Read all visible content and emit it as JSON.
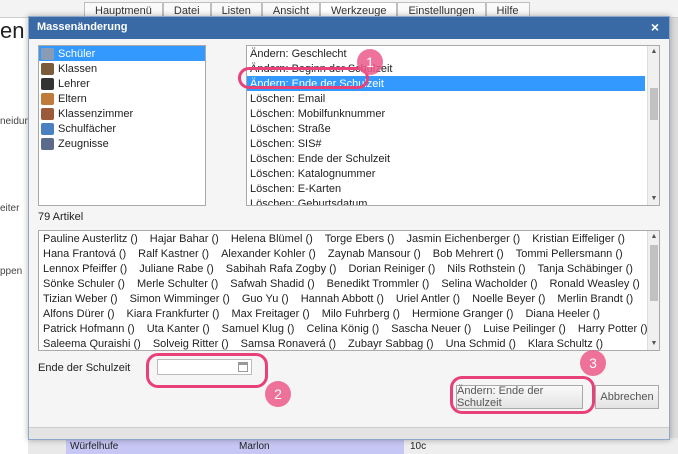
{
  "background": {
    "menu": [
      "Hauptmenü",
      "Datei",
      "Listen",
      "Ansicht",
      "Werkzeuge",
      "Einstellungen",
      "Hilfe"
    ],
    "menu_active_index": 4,
    "title_fragment": "en",
    "side_texts": [
      "neidun",
      "eiter",
      "ppen"
    ],
    "row": [
      "Würfelhufe",
      "Marlon"
    ],
    "row_extra": "10c"
  },
  "dialog": {
    "title": "Massenänderung",
    "close_label": "×",
    "types": [
      {
        "label": "Schüler",
        "icon": "student-icon",
        "selected": true,
        "color": "#8a9bb5"
      },
      {
        "label": "Klassen",
        "icon": "class-icon",
        "selected": false,
        "color": "#7a5b3a"
      },
      {
        "label": "Lehrer",
        "icon": "teacher-icon",
        "selected": false,
        "color": "#333333"
      },
      {
        "label": "Eltern",
        "icon": "parents-icon",
        "selected": false,
        "color": "#c07a3a"
      },
      {
        "label": "Klassenzimmer",
        "icon": "classroom-icon",
        "selected": false,
        "color": "#9b5a3a"
      },
      {
        "label": "Schulfächer",
        "icon": "subjects-icon",
        "selected": false,
        "color": "#4a7fc0"
      },
      {
        "label": "Zeugnisse",
        "icon": "certificate-icon",
        "selected": false,
        "color": "#5a6a8a"
      }
    ],
    "actions": [
      "Ändern: Geschlecht",
      "Ändern: Beginn der Schulzeit",
      "Ändern: Ende der Schulzeit",
      "Löschen: Email",
      "Löschen: Mobilfunknummer",
      "Löschen: Straße",
      "Löschen: SIS#",
      "Löschen: Ende der Schulzeit",
      "Löschen: Katalognummer",
      "Löschen: E-Karten",
      "Löschen: Geburtsdatum"
    ],
    "selected_action_index": 2,
    "count_label": "79 Artikel",
    "students": [
      [
        "Pauline Austerlitz ()",
        "Hajar Bahar ()",
        "Helena Blümel ()",
        "Torge Ebers ()",
        "Jasmin Eichenberger ()",
        "Kristian Eiffeliger ()"
      ],
      [
        "Hana Frantová ()",
        "Ralf Kastner ()",
        "Alexander Kohler ()",
        "Zaynab Mansour ()",
        "Bob Mehrert ()",
        "Tommi Pellersmann ()"
      ],
      [
        "Lennox Pfeiffer ()",
        "Juliane Rabe ()",
        "Sabihah Rafa Zogby ()",
        "Dorian Reiniger ()",
        "Nils Rothstein ()",
        "Tanja Schäbinger ()"
      ],
      [
        "Sönke Schuler ()",
        "Merle Schulter ()",
        "Safwah Shadid ()",
        "Benedikt Trommler ()",
        "Selina Wacholder ()",
        "Ronald Weasley ()"
      ],
      [
        "Tizian Weber ()",
        "Simon Wimminger ()",
        "Guo Yu ()",
        "Hannah Abbott ()",
        "Uriel Antler ()",
        "Noelle Beyer ()",
        "Merlin Brandt ()"
      ],
      [
        "Alfons Dürer ()",
        "Kiara Frankfurter ()",
        "Max Freitager ()",
        "Milo Fuhrberg ()",
        "Hermione Granger ()",
        "Diana Heeler ()"
      ],
      [
        "Patrick Hofmann ()",
        "Uta Kanter ()",
        "Samuel Klug ()",
        "Celina König ()",
        "Sascha Neuer ()",
        "Luise Peilinger ()",
        "Harry Potter ()"
      ],
      [
        "Saleema Quraishi ()",
        "Solveig Ritter ()",
        "Samsa Ronaverá ()",
        "Zubayr Sabbag ()",
        "Una Schmid ()",
        "Klara Schultz ()"
      ]
    ],
    "date_label": "Ende der Schulzeit",
    "date_value": "",
    "apply_label": "Ändern: Ende der Schulzeit",
    "cancel_label": "Abbrechen"
  },
  "annotations": {
    "badges": [
      "1",
      "2",
      "3"
    ],
    "color": "#e8417a"
  }
}
